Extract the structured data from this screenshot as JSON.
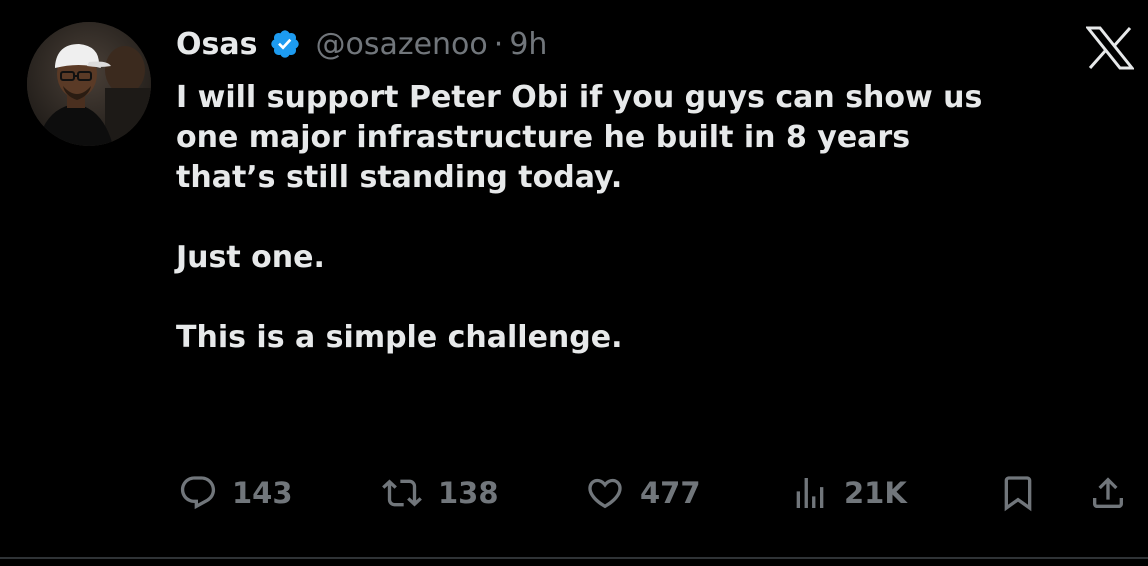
{
  "tweet": {
    "author": {
      "display_name": "Osas",
      "name_suffix_glyph": "",
      "handle": "@osazenoo",
      "separator": "·",
      "time": "9h",
      "verified": true,
      "verified_color": "#1d9bf0"
    },
    "paragraphs": [
      "I will support Peter Obi if you guys can show us\none major infrastructure he built in 8 years\nthat’s still standing today.",
      "Just one.",
      "This is a simple challenge."
    ],
    "metrics": {
      "replies": "143",
      "reposts": "138",
      "likes": "477",
      "views": "21K"
    },
    "icons": {
      "reply": "reply-icon",
      "repost": "repost-icon",
      "like": "heart-icon",
      "views": "views-icon",
      "bookmark": "bookmark-icon",
      "share": "share-icon",
      "platform": "x-logo-icon"
    }
  },
  "colors": {
    "background": "#000000",
    "text_primary": "#e7e9ea",
    "text_secondary": "#71767b",
    "divider": "#2f3336"
  }
}
